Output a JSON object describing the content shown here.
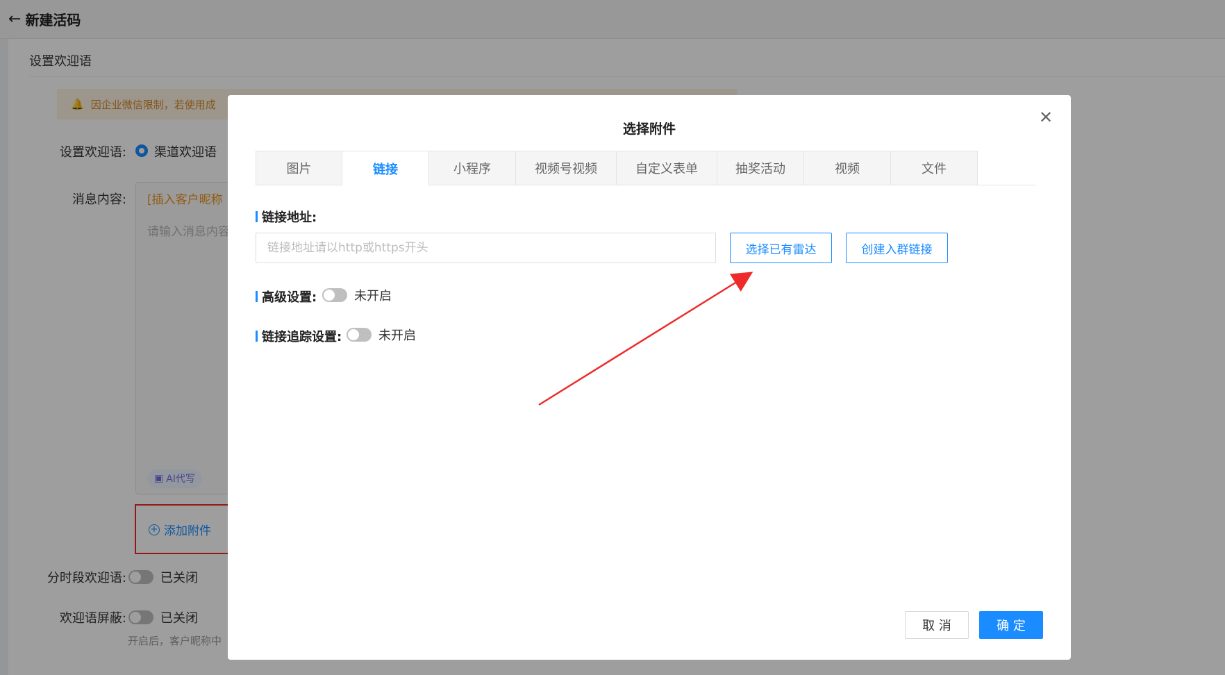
{
  "header": {
    "back_icon": "arrow-left-icon",
    "title": "新建活码"
  },
  "section": {
    "title": "设置欢迎语"
  },
  "notice": {
    "icon": "bell-icon",
    "text": "因企业微信限制，若使用成"
  },
  "welcome": {
    "label": "设置欢迎语:",
    "option": "渠道欢迎语"
  },
  "message": {
    "label": "消息内容:",
    "insert_tag": "[插入客户昵称",
    "placeholder": "请输入消息内容",
    "ai_chip": "AI代写",
    "add_attachment": "添加附件"
  },
  "timed": {
    "label": "分时段欢迎语:",
    "status": "已关闭"
  },
  "shield": {
    "label": "欢迎语屏蔽:",
    "status": "已关闭",
    "hint": "开启后，客户昵称中"
  },
  "modal": {
    "title": "选择附件",
    "close_icon": "close-icon",
    "tabs": [
      {
        "label": "图片",
        "active": false
      },
      {
        "label": "链接",
        "active": true
      },
      {
        "label": "小程序",
        "active": false
      },
      {
        "label": "视频号视频",
        "active": false
      },
      {
        "label": "自定义表单",
        "active": false
      },
      {
        "label": "抽奖活动",
        "active": false
      },
      {
        "label": "视频",
        "active": false
      },
      {
        "label": "文件",
        "active": false
      }
    ],
    "url_label": "链接地址:",
    "url_value": "",
    "url_placeholder": "链接地址请以http或https开头",
    "select_radar_button": "选择已有雷达",
    "create_group_link_button": "创建入群链接",
    "advanced_label": "高级设置:",
    "advanced_status": "未开启",
    "tracking_label": "链接追踪设置:",
    "tracking_status": "未开启",
    "cancel_button": "取 消",
    "ok_button": "确 定"
  },
  "colors": {
    "primary": "#1a8cff",
    "annotation": "#ee2a2a",
    "warning": "#e8921a"
  }
}
